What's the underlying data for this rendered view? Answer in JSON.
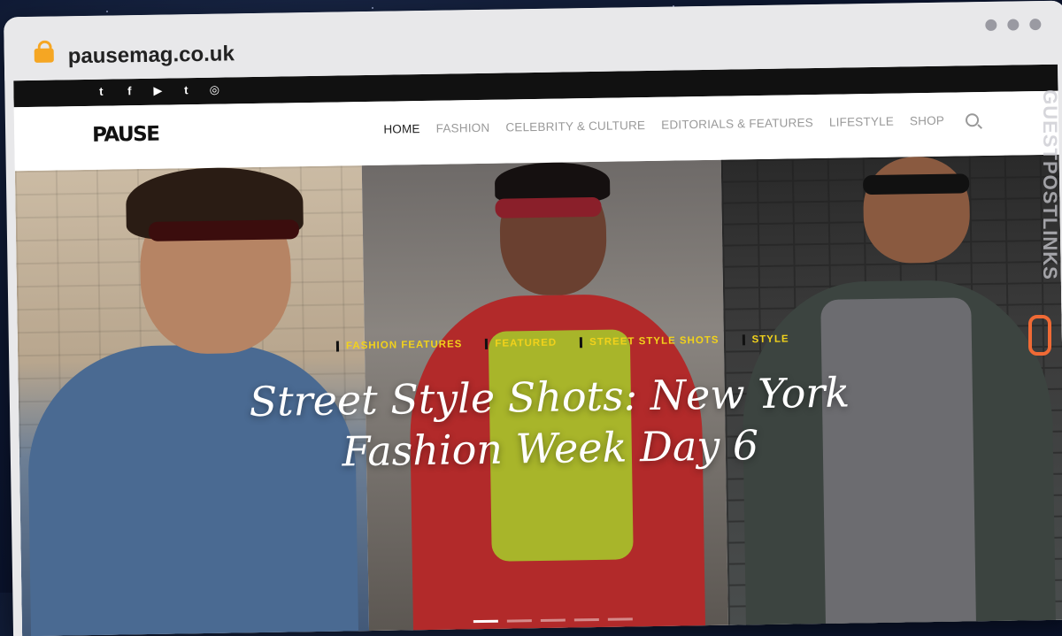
{
  "browser": {
    "url": "pausemag.co.uk"
  },
  "topbar": {
    "social_icons": [
      {
        "name": "twitter-icon",
        "glyph": "t"
      },
      {
        "name": "facebook-icon",
        "glyph": "f"
      },
      {
        "name": "youtube-icon",
        "glyph": "▶"
      },
      {
        "name": "tumblr-icon",
        "glyph": "t"
      },
      {
        "name": "instagram-icon",
        "glyph": "◎"
      }
    ]
  },
  "header": {
    "logo": "PAUSE",
    "nav": [
      "HOME",
      "FASHION",
      "CELEBRITY & CULTURE",
      "EDITORIALS & FEATURES",
      "LIFESTYLE",
      "SHOP"
    ],
    "active_nav": "HOME",
    "search_icon": "search-icon"
  },
  "hero": {
    "categories": [
      "FASHION FEATURES",
      "FEATURED",
      "STREET STYLE SHOTS",
      "STYLE"
    ],
    "title_line1": "Street Style Shots: New York",
    "title_line2": "Fashion Week Day 6",
    "slides": 5,
    "active_slide": 1
  },
  "watermark": {
    "text": "GUESTPOSTLINKS",
    "accent": "#f06a35"
  },
  "colors": {
    "category_text": "#f2d21b",
    "topbar": "#111111"
  }
}
